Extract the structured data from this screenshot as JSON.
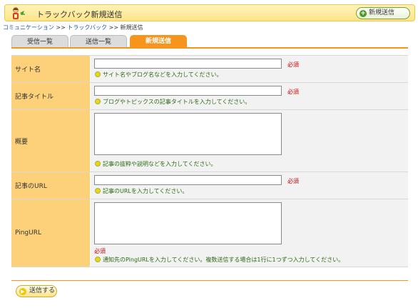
{
  "header": {
    "title": "トラックバック新規送信",
    "new_button_label": "新規送信"
  },
  "breadcrumb": {
    "items": [
      "コミュニケーション",
      "トラックバック"
    ],
    "separator": ">>",
    "current": "新規送信"
  },
  "tabs": [
    {
      "label": "受信一覧",
      "active": false
    },
    {
      "label": "送信一覧",
      "active": false
    },
    {
      "label": "新規送信",
      "active": true
    }
  ],
  "form": {
    "site_name": {
      "label": "サイト名",
      "value": "",
      "required": "必須",
      "hint": "サイト名やブログ名などを入力してください。"
    },
    "article_title": {
      "label": "記事タイトル",
      "value": "",
      "required": "必須",
      "hint": "ブログやトピックスの記事タイトルを入力してください。"
    },
    "summary": {
      "label": "概要",
      "value": "",
      "hint": "記事の抜粋や説明などを入力してください。"
    },
    "article_url": {
      "label": "記事のURL",
      "value": "",
      "required": "必須",
      "hint": "記事のURLを入力してください。"
    },
    "ping_url": {
      "label": "PingURL",
      "value": "",
      "required": "必須",
      "hint": "通知先のPingURLを入力してください。複数送信する場合は1行に1つずつ入力してください。"
    }
  },
  "submit_label": "送信する",
  "colors": {
    "accent": "#f7941d",
    "label_bg": "#fcd17a",
    "field_bg": "#f2f2f2",
    "required": "#cc0000",
    "hint": "#2d6b10"
  }
}
